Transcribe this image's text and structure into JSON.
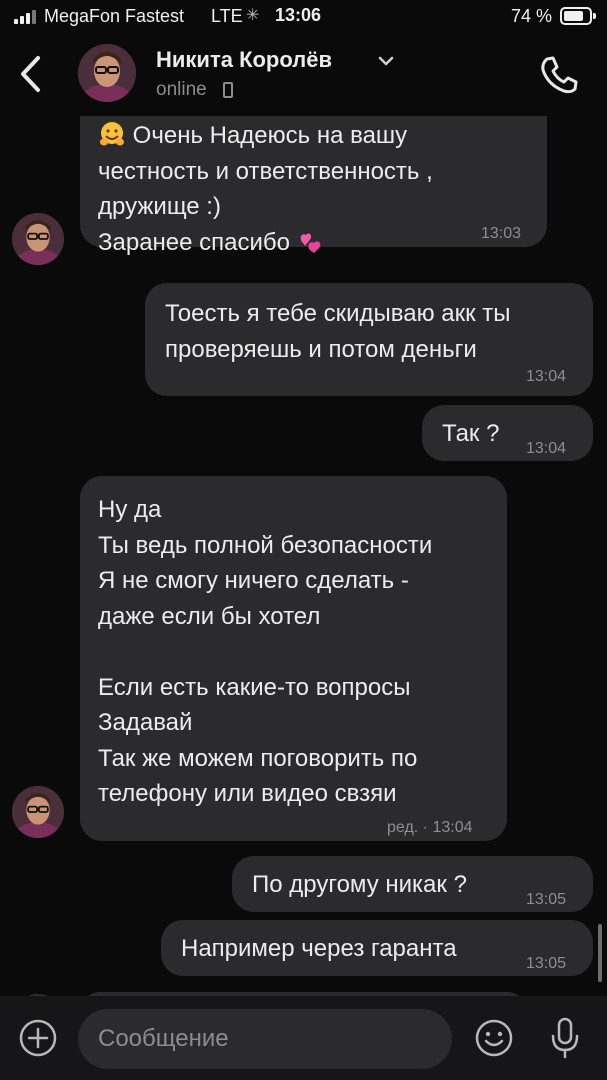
{
  "status_bar": {
    "carrier": "MegaFon Fastest",
    "network": "LTE",
    "time": "13:06",
    "battery_percent": "74 %"
  },
  "header": {
    "contact_name": "Никита Королёв",
    "presence": "online"
  },
  "messages": [
    {
      "direction": "incoming",
      "text": "Очень Надеюсь на вашу\nчестность и ответственность ,\nдружище :)\nЗаранее спасибо",
      "leading_emoji": "hugging-face",
      "trailing_emoji": "two-hearts",
      "time": "13:03"
    },
    {
      "direction": "outgoing",
      "text": "Тоесть я тебе скидываю акк ты\nпроверяешь и потом деньги",
      "time": "13:04"
    },
    {
      "direction": "outgoing",
      "text": "Так ?",
      "time": "13:04"
    },
    {
      "direction": "incoming",
      "text": "Ну да\nТы ведь полной безопасности\nЯ не смогу ничего сделать -\nдаже если бы хотел\n\nЕсли есть какие-то вопросы\nЗадавай\nТак же можем поговорить по\nтелефону или видео свзяи",
      "time": "ред. · 13:04"
    },
    {
      "direction": "outgoing",
      "text": "По другому никак ?",
      "time": "13:05"
    },
    {
      "direction": "outgoing",
      "text": "Например через гаранта",
      "time": "13:05"
    }
  ],
  "composer": {
    "placeholder": "Сообщение"
  },
  "colors": {
    "background": "#0a0a0a",
    "bubble": "#2b2b2e",
    "text": "#ececec",
    "muted": "#8e8e92",
    "composer_bar": "#161618"
  }
}
